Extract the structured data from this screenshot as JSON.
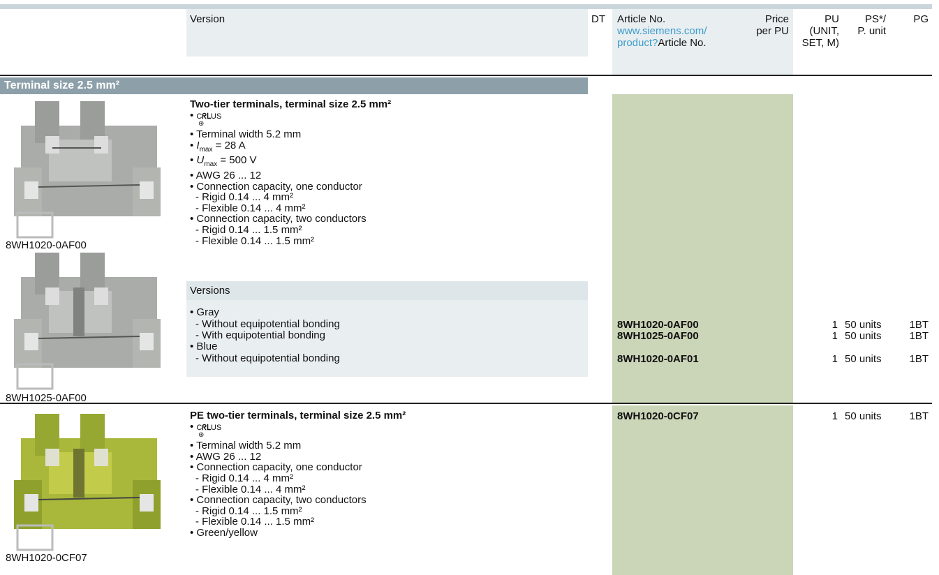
{
  "header": {
    "version": "Version",
    "dt": "DT",
    "article_no": "Article No.",
    "article_link_line1": "www.siemens.com/",
    "article_link_line2": "product?",
    "article_link_suffix": "Article No.",
    "price_line1": "Price",
    "price_line2": "per PU",
    "pu_line1": "PU",
    "pu_line2": "(UNIT,",
    "pu_line3": "SET, M)",
    "ps_line1": "PS*/",
    "ps_line2": "P. unit",
    "pg": "PG"
  },
  "section_title": "Terminal size 2.5 mm²",
  "colors": {
    "article_column": "#cbd5b8",
    "section_band": "#8da0aa",
    "link": "#3c9ccc"
  },
  "product1": {
    "title": "Two-tier terminals, terminal size 2.5 mm²",
    "approval_c": "C",
    "approval_us": "US",
    "width": "Terminal width 5.2 mm",
    "imax_label": "I",
    "imax_sub": "max",
    "imax_value": " = 28 A",
    "umax_label": "U",
    "umax_sub": "max",
    "umax_value": " = 500 V",
    "awg": "AWG 26 ... 12",
    "cap_one": "Connection capacity, one conductor",
    "cap_one_rigid": "- Rigid 0.14 ... 4 mm²",
    "cap_one_flex": "- Flexible 0.14 ... 4 mm²",
    "cap_two": "Connection capacity, two conductors",
    "cap_two_rigid": "- Rigid 0.14 ... 1.5 mm²",
    "cap_two_flex": "- Flexible 0.14 ... 1.5 mm²",
    "image_caption_1": "8WH1020-0AF00",
    "image_caption_2": "8WH1025-0AF00",
    "versions_label": "Versions",
    "gray": "Gray",
    "blue": "Blue",
    "rows": [
      {
        "label": "- Without equipotential bonding",
        "article": "8WH1020-0AF00",
        "pu": "1",
        "ps": "50 units",
        "pg": "1BT"
      },
      {
        "label": "- With equipotential bonding",
        "article": "8WH1025-0AF00",
        "pu": "1",
        "ps": "50 units",
        "pg": "1BT"
      },
      {
        "label": "- Without equipotential bonding",
        "article": "8WH1020-0AF01",
        "pu": "1",
        "ps": "50 units",
        "pg": "1BT"
      }
    ]
  },
  "product2": {
    "title": "PE two-tier terminals, terminal size 2.5 mm²",
    "approval_c": "C",
    "approval_us": "US",
    "width": "Terminal width 5.2 mm",
    "awg": "AWG 26 ... 12",
    "cap_one": "Connection capacity, one conductor",
    "cap_one_rigid": "- Rigid 0.14 ... 4 mm²",
    "cap_one_flex": "- Flexible 0.14 ... 4 mm²",
    "cap_two": "Connection capacity, two conductors",
    "cap_two_rigid": "- Rigid 0.14 ... 1.5 mm²",
    "cap_two_flex": "- Flexible 0.14 ... 1.5 mm²",
    "color": "Green/yellow",
    "image_caption": "8WH1020-0CF07",
    "article": "8WH1020-0CF07",
    "pu": "1",
    "ps": "50 units",
    "pg": "1BT"
  }
}
